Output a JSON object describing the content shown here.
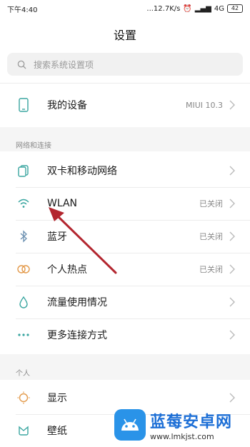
{
  "status": {
    "time": "下午4:40",
    "speed": "...12.7K/s",
    "network": "4G",
    "battery": "42"
  },
  "page": {
    "title": "设置"
  },
  "search": {
    "placeholder": "搜索系统设置项"
  },
  "device": {
    "label": "我的设备",
    "value": "MIUI 10.3",
    "icon": "phone-icon"
  },
  "sections": {
    "network": "网络和连接",
    "personal": "个人"
  },
  "network_items": [
    {
      "label": "双卡和移动网络",
      "value": "",
      "icon": "sim-cards-icon"
    },
    {
      "label": "WLAN",
      "value": "已关闭",
      "icon": "wifi-icon"
    },
    {
      "label": "蓝牙",
      "value": "已关闭",
      "icon": "bluetooth-icon"
    },
    {
      "label": "个人热点",
      "value": "已关闭",
      "icon": "hotspot-icon"
    },
    {
      "label": "流量使用情况",
      "value": "",
      "icon": "data-usage-icon"
    },
    {
      "label": "更多连接方式",
      "value": "",
      "icon": "more-connections-icon"
    }
  ],
  "personal_items": [
    {
      "label": "显示",
      "value": "",
      "icon": "brightness-icon"
    },
    {
      "label": "壁纸",
      "value": "",
      "icon": "wallpaper-icon"
    }
  ],
  "watermark": {
    "title": "蓝莓安卓网",
    "url": "www.lmkjst.com"
  },
  "colors": {
    "accent_icon": "#3aa6a0",
    "hotspot": "#e39a4b",
    "arrow": "#b3262f",
    "watermark": "#1d6fd6"
  }
}
